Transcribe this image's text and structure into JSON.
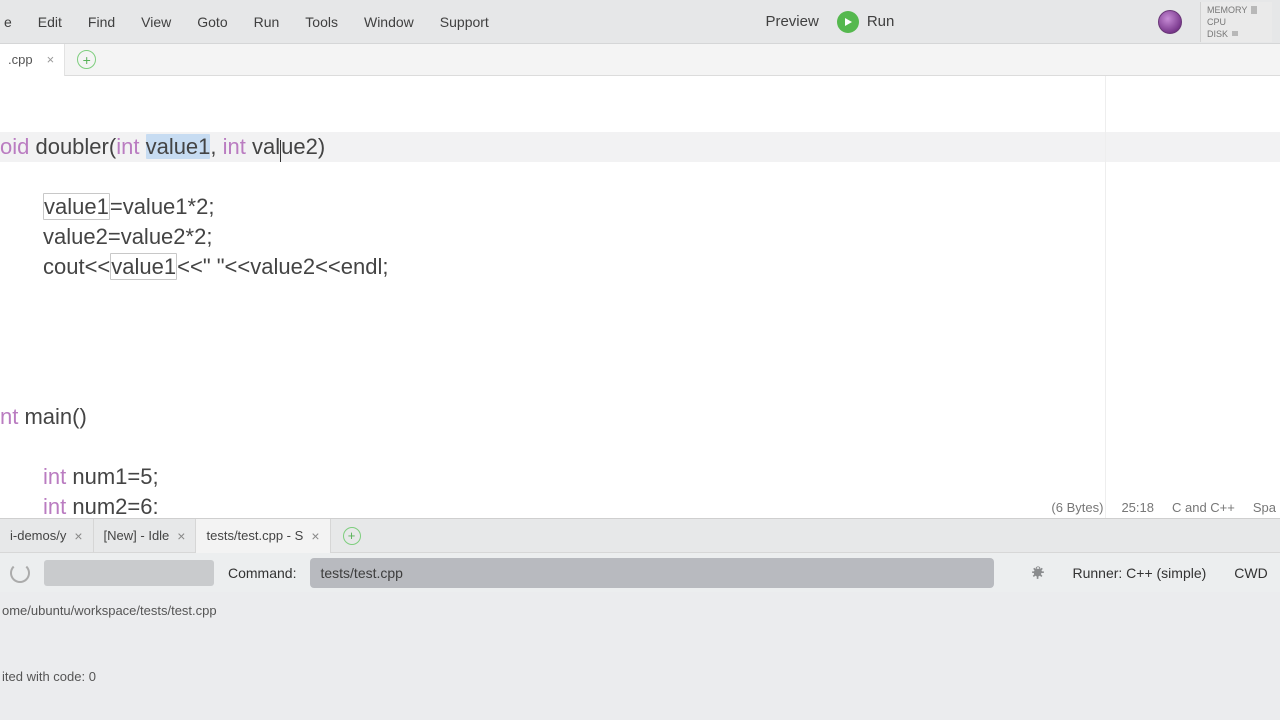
{
  "menu": {
    "items": [
      "e",
      "Edit",
      "Find",
      "View",
      "Goto",
      "Run",
      "Tools",
      "Window",
      "Support"
    ]
  },
  "topbar": {
    "preview": "Preview",
    "run": "Run"
  },
  "resources": {
    "memory": "MEMORY",
    "cpu": "CPU",
    "disk": "DISK"
  },
  "editor_tab": {
    "label": ".cpp"
  },
  "code": {
    "l1_kw1": "oid",
    "l1_name": " doubler(",
    "l1_kw2": "int",
    "l1_sel": "value1",
    "l1_tail": ", ",
    "l1_kw3": "int",
    "l1_p2": " val",
    "l1_p3": "ue2)",
    "l2a": "value1",
    "l2b": "=value1*",
    "l2c": "2",
    "l2d": ";",
    "l3a": "value2",
    "l3b": "=value2*",
    "l3c": "2",
    "l3d": ";",
    "l4p1": "cout<<",
    "l4p2": "value1",
    "l4p3": "<<\" \"<<value2<<endl;",
    "l5_kw": "nt",
    "l5_tail": " main()",
    "l6_kw": "int",
    "l6_tail": " num1=",
    "l6_num": "5",
    "l6_semi": ";",
    "l7_kw": "int",
    "l7_tail": " num2=",
    "l7_num": "6",
    "l7_semi": ":"
  },
  "status": {
    "bytes": "(6 Bytes)",
    "cursor": "25:18",
    "lang": "C and C++",
    "spaces": "Spa"
  },
  "term_tabs": {
    "t1": "i-demos/y",
    "t2": "[New] - Idle",
    "t3": "tests/test.cpp - S"
  },
  "runner": {
    "command_label": "Command:",
    "command_value": "tests/test.cpp",
    "runner_label": "Runner: C++ (simple)",
    "cwd_label": "CWD"
  },
  "console": {
    "path": "ome/ubuntu/workspace/tests/test.cpp",
    "exit_line": "ited with code: 0"
  }
}
